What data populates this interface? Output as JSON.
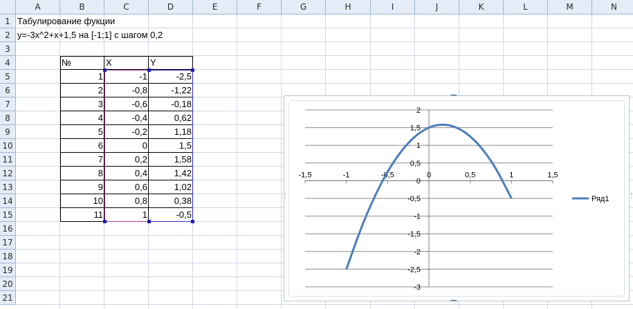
{
  "columns": [
    "A",
    "B",
    "C",
    "D",
    "E",
    "F",
    "G",
    "H",
    "I",
    "J",
    "K",
    "L",
    "M",
    "N"
  ],
  "rows": [
    "1",
    "2",
    "3",
    "4",
    "5",
    "6",
    "7",
    "8",
    "9",
    "10",
    "11",
    "12",
    "13",
    "14",
    "15",
    "16",
    "17",
    "18",
    "19",
    "20",
    "21"
  ],
  "cells": {
    "a1": "Табулирование фукции",
    "a2": "y=-3x^2+x+1,5 на [-1;1] с шагом 0,2"
  },
  "table": {
    "headers": [
      "№",
      "X",
      "Y"
    ],
    "rows": [
      [
        "1",
        "-1",
        "-2,5"
      ],
      [
        "2",
        "-0,8",
        "-1,22"
      ],
      [
        "3",
        "-0,6",
        "-0,18"
      ],
      [
        "4",
        "-0,4",
        "0,62"
      ],
      [
        "5",
        "-0,2",
        "1,18"
      ],
      [
        "6",
        "0",
        "1,5"
      ],
      [
        "7",
        "0,2",
        "1,58"
      ],
      [
        "8",
        "0,4",
        "1,42"
      ],
      [
        "9",
        "0,6",
        "1,02"
      ],
      [
        "10",
        "0,8",
        "0,38"
      ],
      [
        "11",
        "1",
        "-0,5"
      ]
    ]
  },
  "chart_data": {
    "type": "scatter",
    "smooth": true,
    "series": [
      {
        "name": "Ряд1",
        "color": "#4a7ebb",
        "x": [
          -1,
          -0.8,
          -0.6,
          -0.4,
          -0.2,
          0,
          0.2,
          0.4,
          0.6,
          0.8,
          1
        ],
        "y": [
          -2.5,
          -1.22,
          -0.18,
          0.62,
          1.18,
          1.5,
          1.58,
          1.42,
          1.02,
          0.38,
          -0.5
        ]
      }
    ],
    "xlim": [
      -1.5,
      1.5
    ],
    "ylim": [
      -3,
      2
    ],
    "x_ticks": [
      -1.5,
      -1,
      -0.5,
      0,
      0.5,
      1,
      1.5
    ],
    "x_tick_labels": [
      "-1,5",
      "-1",
      "-0,5",
      "0",
      "0,5",
      "1",
      "1,5"
    ],
    "y_ticks": [
      2,
      1.5,
      1,
      0.5,
      0,
      -0.5,
      -1,
      -1.5,
      -2,
      -2.5,
      -3
    ],
    "y_tick_labels": [
      "2",
      "1,5",
      "1",
      "0,5",
      "0",
      "-0,5",
      "-1",
      "-1,5",
      "-2",
      "-2,5",
      "-3"
    ],
    "grid": "horizontal",
    "legend": "right"
  }
}
